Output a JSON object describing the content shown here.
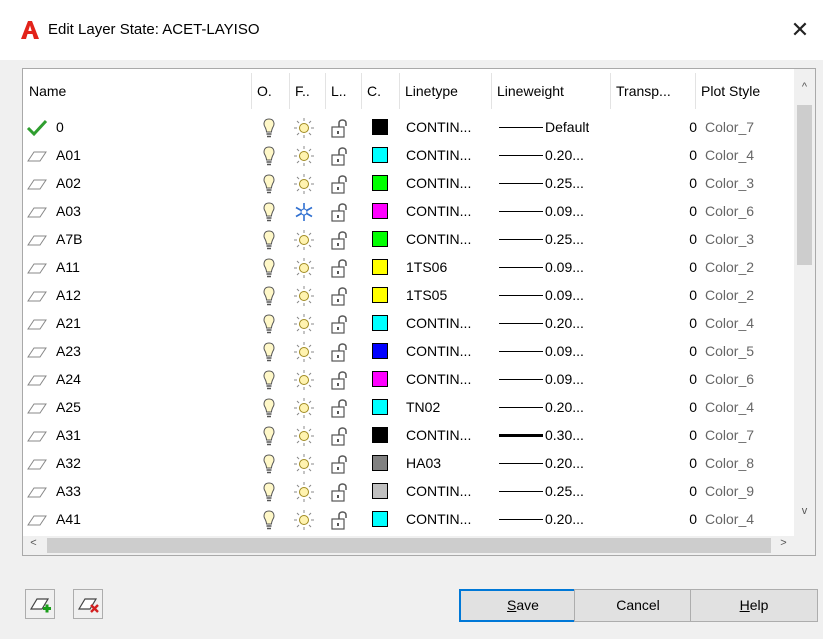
{
  "window": {
    "title": "Edit Layer State: ACET-LAYISO",
    "close_label": "✕"
  },
  "columns": [
    {
      "key": "name",
      "label": "Name"
    },
    {
      "key": "on",
      "label": "O."
    },
    {
      "key": "freeze",
      "label": "F.."
    },
    {
      "key": "lock",
      "label": "L.."
    },
    {
      "key": "color",
      "label": "C."
    },
    {
      "key": "linetype",
      "label": "Linetype"
    },
    {
      "key": "lineweight",
      "label": "Lineweight"
    },
    {
      "key": "transparency",
      "label": "Transp..."
    },
    {
      "key": "plotstyle",
      "label": "Plot Style"
    }
  ],
  "rows": [
    {
      "name": "0",
      "current": true,
      "frozen": false,
      "color": "#000000",
      "linetype": "CONTIN...",
      "lineweight": "Default",
      "thick": false,
      "transparency": "0",
      "plot_style": "Color_7"
    },
    {
      "name": "A01",
      "current": false,
      "frozen": false,
      "color": "#00ffff",
      "linetype": "CONTIN...",
      "lineweight": "0.20...",
      "thick": false,
      "transparency": "0",
      "plot_style": "Color_4"
    },
    {
      "name": "A02",
      "current": false,
      "frozen": false,
      "color": "#00ff00",
      "linetype": "CONTIN...",
      "lineweight": "0.25...",
      "thick": false,
      "transparency": "0",
      "plot_style": "Color_3"
    },
    {
      "name": "A03",
      "current": false,
      "frozen": true,
      "color": "#ff00ff",
      "linetype": "CONTIN...",
      "lineweight": "0.09...",
      "thick": false,
      "transparency": "0",
      "plot_style": "Color_6"
    },
    {
      "name": "A7B",
      "current": false,
      "frozen": false,
      "color": "#00ff00",
      "linetype": "CONTIN...",
      "lineweight": "0.25...",
      "thick": false,
      "transparency": "0",
      "plot_style": "Color_3"
    },
    {
      "name": "A11",
      "current": false,
      "frozen": false,
      "color": "#ffff00",
      "linetype": "1TS06",
      "lineweight": "0.09...",
      "thick": false,
      "transparency": "0",
      "plot_style": "Color_2"
    },
    {
      "name": "A12",
      "current": false,
      "frozen": false,
      "color": "#ffff00",
      "linetype": "1TS05",
      "lineweight": "0.09...",
      "thick": false,
      "transparency": "0",
      "plot_style": "Color_2"
    },
    {
      "name": "A21",
      "current": false,
      "frozen": false,
      "color": "#00ffff",
      "linetype": "CONTIN...",
      "lineweight": "0.20...",
      "thick": false,
      "transparency": "0",
      "plot_style": "Color_4"
    },
    {
      "name": "A23",
      "current": false,
      "frozen": false,
      "color": "#0000ff",
      "linetype": "CONTIN...",
      "lineweight": "0.09...",
      "thick": false,
      "transparency": "0",
      "plot_style": "Color_5"
    },
    {
      "name": "A24",
      "current": false,
      "frozen": false,
      "color": "#ff00ff",
      "linetype": "CONTIN...",
      "lineweight": "0.09...",
      "thick": false,
      "transparency": "0",
      "plot_style": "Color_6"
    },
    {
      "name": "A25",
      "current": false,
      "frozen": false,
      "color": "#00ffff",
      "linetype": "TN02",
      "lineweight": "0.20...",
      "thick": false,
      "transparency": "0",
      "plot_style": "Color_4"
    },
    {
      "name": "A31",
      "current": false,
      "frozen": false,
      "color": "#000000",
      "linetype": "CONTIN...",
      "lineweight": "0.30...",
      "thick": true,
      "transparency": "0",
      "plot_style": "Color_7"
    },
    {
      "name": "A32",
      "current": false,
      "frozen": false,
      "color": "#808080",
      "linetype": "HA03",
      "lineweight": "0.20...",
      "thick": false,
      "transparency": "0",
      "plot_style": "Color_8"
    },
    {
      "name": "A33",
      "current": false,
      "frozen": false,
      "color": "#c0c0c0",
      "linetype": "CONTIN...",
      "lineweight": "0.25...",
      "thick": false,
      "transparency": "0",
      "plot_style": "Color_9"
    },
    {
      "name": "A41",
      "current": false,
      "frozen": false,
      "color": "#00ffff",
      "linetype": "CONTIN...",
      "lineweight": "0.20...",
      "thick": false,
      "transparency": "0",
      "plot_style": "Color_4"
    },
    {
      "name": "",
      "current": false,
      "frozen": false,
      "color": "#ff0000",
      "linetype": "",
      "lineweight": "",
      "thick": false,
      "transparency": "",
      "plot_style": ""
    }
  ],
  "buttons": {
    "save": {
      "label_accel": "S",
      "label_rest": "ave"
    },
    "cancel": {
      "label": "Cancel"
    },
    "help": {
      "label_accel": "H",
      "label_rest": "elp"
    }
  },
  "icons": {
    "app": "autocad-a-icon",
    "import_layers": "import-layers-icon",
    "remove_layers": "remove-layers-icon"
  },
  "colors": {
    "accent": "#0078d7",
    "app_red": "#e2231a"
  }
}
